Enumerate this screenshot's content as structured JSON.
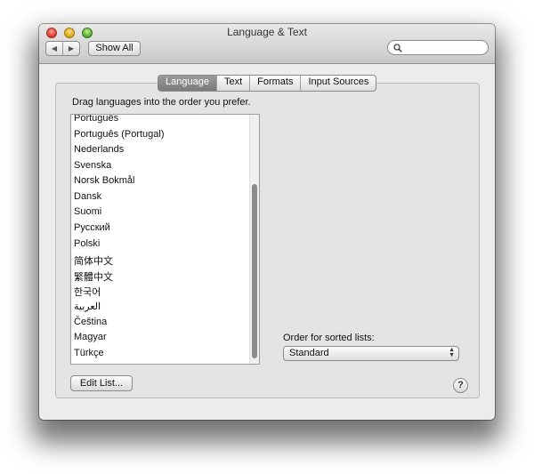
{
  "window": {
    "title": "Language & Text"
  },
  "toolbar": {
    "back_icon": "triangle-left-icon",
    "forward_icon": "triangle-right-icon",
    "show_all_label": "Show All",
    "search_value": "",
    "search_icon": "magnifier-icon"
  },
  "tabs": [
    {
      "label": "Language",
      "active": true
    },
    {
      "label": "Text",
      "active": false
    },
    {
      "label": "Formats",
      "active": false
    },
    {
      "label": "Input Sources",
      "active": false
    }
  ],
  "language_pane": {
    "instruction": "Drag languages into the order you prefer.",
    "languages": [
      "Português",
      "Português (Portugal)",
      "Nederlands",
      "Svenska",
      "Norsk Bokmål",
      "Dansk",
      "Suomi",
      "Русский",
      "Polski",
      "简体中文",
      "繁體中文",
      "한국어",
      "العربية",
      "Čeština",
      "Magyar",
      "Türkçe"
    ],
    "order_label": "Order for sorted lists:",
    "order_value": "Standard",
    "edit_list_label": "Edit List...",
    "help_label": "?"
  }
}
